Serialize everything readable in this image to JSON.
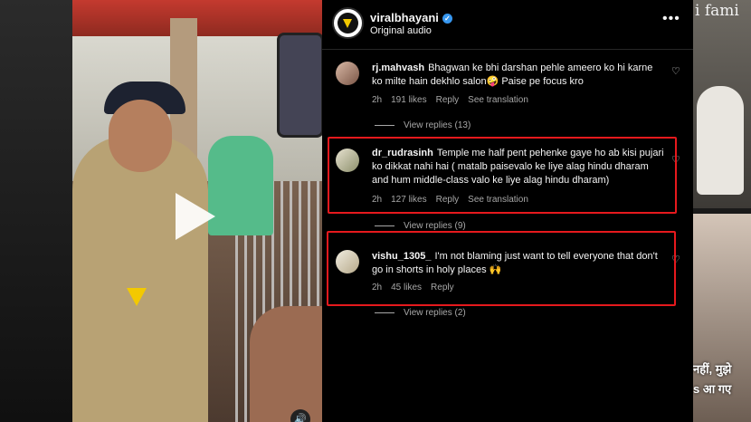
{
  "header": {
    "username": "viralbhayani",
    "audio": "Original audio"
  },
  "comments": [
    {
      "username": "rj.mahvash",
      "text": "Bhagwan ke bhi darshan pehle ameero ko hi karne ko milte hain dekhlo salon🤪  Paise pe focus kro",
      "time": "2h",
      "likes": "191 likes",
      "reply": "Reply",
      "translate": "See translation",
      "view_replies": "View replies (13)"
    },
    {
      "username": "dr_rudrasinh",
      "text": "Temple me half pent pehenke gaye ho ab kisi pujari ko dikkat nahi hai ( matalb paisevalo ke liye alag hindu dharam and hum middle-class valo ke liye alag hindu dharam)",
      "time": "2h",
      "likes": "127 likes",
      "reply": "Reply",
      "translate": "See translation",
      "view_replies": "View replies (9)"
    },
    {
      "username": "vishu_1305_",
      "text": "I'm not blaming just want to tell everyone that don't go in shorts in holy places 🙌",
      "time": "2h",
      "likes": "45 likes",
      "reply": "Reply",
      "view_replies": "View replies (2)"
    }
  ],
  "background": {
    "right_title": "i fami",
    "right_caption_1": "नहीं, मुझे",
    "right_caption_2": "s आ गए"
  },
  "colors": {
    "highlight": "#e6191d",
    "verified": "#3797f0",
    "brand": "#f3c900"
  }
}
